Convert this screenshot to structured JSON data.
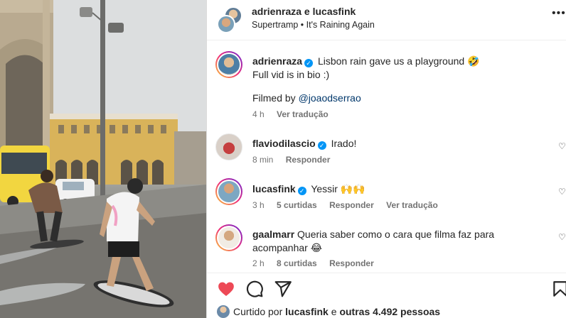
{
  "header": {
    "names": "adrienraza e lucasfink",
    "audio": "Supertramp • It's Raining Again",
    "more": "•••"
  },
  "caption": {
    "username": "adrienraza",
    "text_line1": "Lisbon rain gave us a playground",
    "emoji": "🤣",
    "text_line2": "Full vid is in bio :)",
    "filmed_prefix": "Filmed by",
    "filmed_mention": "@joaodserrao",
    "time": "4 h",
    "translate": "Ver tradução"
  },
  "comments": [
    {
      "username": "flaviodilascio",
      "verified": true,
      "text": "Irado!",
      "time": "8 min",
      "reply": "Responder"
    },
    {
      "username": "lucasfink",
      "verified": true,
      "text": "Yessir 🙌🙌",
      "time": "3 h",
      "likes": "5 curtidas",
      "reply": "Responder",
      "translate": "Ver tradução"
    },
    {
      "username": "gaalmarr",
      "verified": false,
      "text_line1": "Queria saber como o cara que filma faz para",
      "text_line2": "acompanhar 😂",
      "time": "2 h",
      "likes": "8 curtidas",
      "reply": "Responder"
    }
  ],
  "likes": {
    "prefix": "Curtido por",
    "user": "lucasfink",
    "middle": "e",
    "others": "outras 4.492 pessoas"
  },
  "icons": {
    "like": "heart-icon-filled",
    "comment": "comment-icon",
    "share": "share-icon",
    "save": "bookmark-icon",
    "verified": "verified-badge-icon",
    "comment_like": "heart-outline-icon"
  },
  "colors": {
    "like": "#ed4956",
    "verified": "#0095f6",
    "mention": "#00376b",
    "secondary_text": "#737373"
  }
}
